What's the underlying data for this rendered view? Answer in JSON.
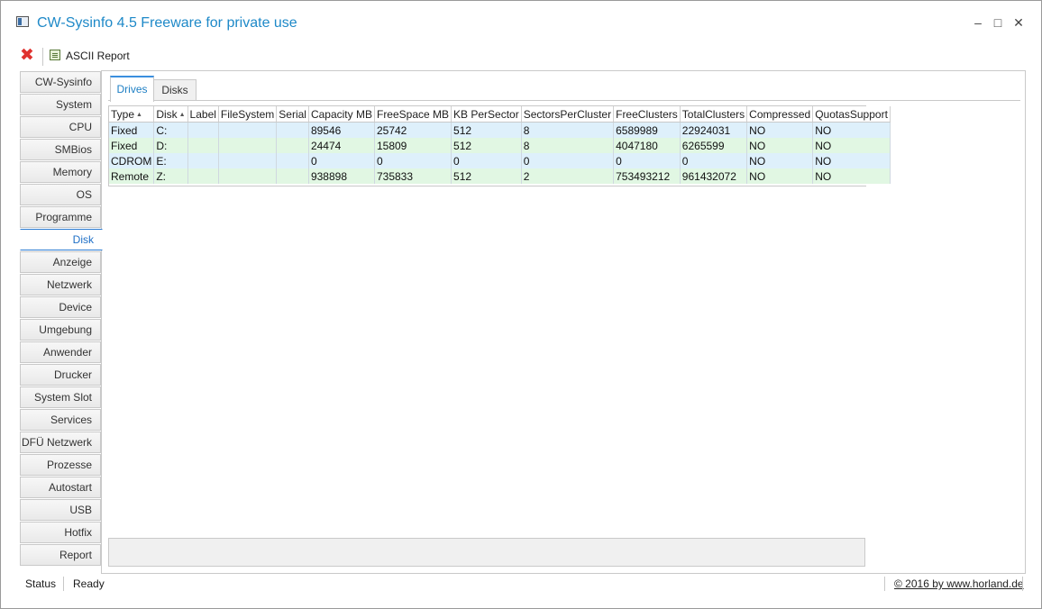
{
  "window": {
    "title": "CW-Sysinfo 4.5 Freeware for private use",
    "minimize_glyph": "–",
    "maximize_glyph": "□",
    "close_glyph": "✕"
  },
  "toolbar": {
    "close_glyph": "✖",
    "report_label": "ASCII Report"
  },
  "sidebar": {
    "items": [
      "CW-Sysinfo",
      "System",
      "CPU",
      "SMBios",
      "Memory",
      "OS",
      "Programme",
      "Disk",
      "Anzeige",
      "Netzwerk",
      "Device",
      "Umgebung",
      "Anwender",
      "Drucker",
      "System Slot",
      "Services",
      "DFÜ Netzwerk",
      "Prozesse",
      "Autostart",
      "USB",
      "Hotfix",
      "Report"
    ],
    "active": "Disk"
  },
  "tabs": {
    "drives": "Drives",
    "disks": "Disks"
  },
  "table": {
    "columns": [
      "Type",
      "Disk",
      "Label",
      "FileSystem",
      "Serial",
      "Capacity MB",
      "FreeSpace MB",
      "KB PerSector",
      "SectorsPerCluster",
      "FreeClusters",
      "TotalClusters",
      "Compressed",
      "QuotasSupport"
    ],
    "rows": [
      [
        "Fixed",
        "C:",
        "",
        "",
        "",
        "89546",
        "25742",
        "512",
        "8",
        "6589989",
        "22924031",
        "NO",
        "NO"
      ],
      [
        "Fixed",
        "D:",
        "",
        "",
        "",
        "24474",
        "15809",
        "512",
        "8",
        "4047180",
        "6265599",
        "NO",
        "NO"
      ],
      [
        "CDROM",
        "E:",
        "",
        "",
        "",
        "0",
        "0",
        "0",
        "0",
        "0",
        "0",
        "NO",
        "NO"
      ],
      [
        "Remote",
        "Z:",
        "",
        "",
        "",
        "938898",
        "735833",
        "512",
        "2",
        "753493212",
        "961432072",
        "NO",
        "NO"
      ]
    ]
  },
  "statusbar": {
    "label": "Status",
    "value": "Ready",
    "copyright": "© 2016 by www.horland.de"
  },
  "colors": {
    "title": "#1e89c8",
    "active_tab": "#1e7fc4",
    "row_blue": "#def0fb",
    "row_green": "#e1f7e3"
  }
}
